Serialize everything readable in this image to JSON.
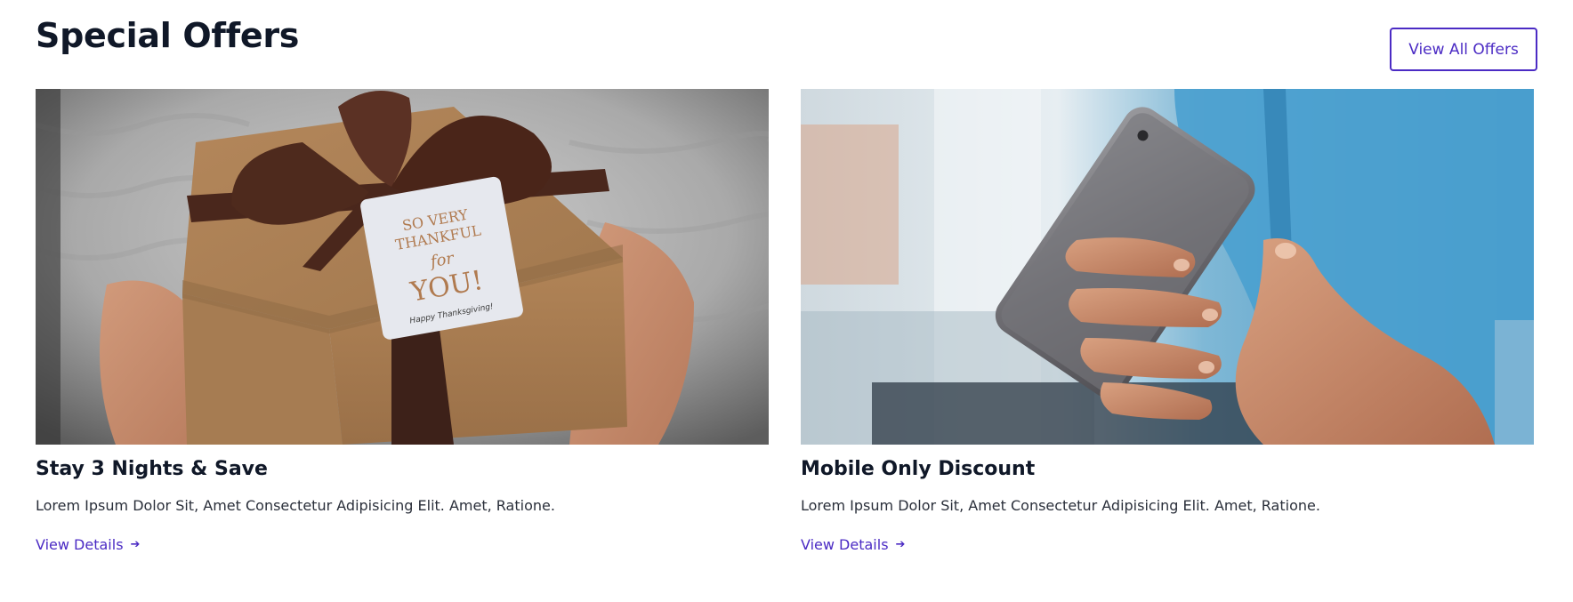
{
  "section": {
    "title": "Special Offers",
    "view_all_label": "View All Offers"
  },
  "colors": {
    "accent": "#4b2bc4",
    "title": "#101828"
  },
  "offers": [
    {
      "title": "Stay 3 Nights & Save",
      "description": "Lorem Ipsum Dolor Sit, Amet Consectetur Adipisicing Elit. Amet, Ratione.",
      "link_label": "View Details",
      "link_icon": "arrow-right-icon",
      "image_alt": "Hands holding a kraft gift box with brown ribbon",
      "image_text": {
        "line1": "SO VERY",
        "line2": "THANKFUL",
        "line3": "for",
        "line4": "YOU!",
        "line5": "Happy Thanksgiving!"
      }
    },
    {
      "title": "Mobile Only Discount",
      "description": "Lorem Ipsum Dolor Sit, Amet Consectetur Adipisicing Elit. Amet, Ratione.",
      "link_label": "View Details",
      "link_icon": "arrow-right-icon",
      "image_alt": "Hand holding a smartphone"
    }
  ]
}
